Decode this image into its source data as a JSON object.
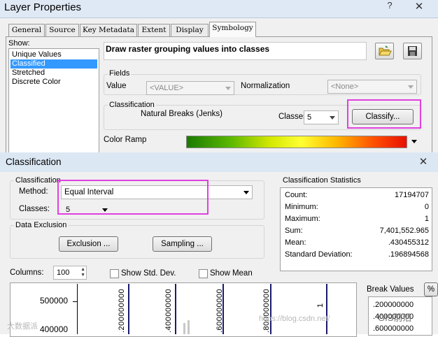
{
  "layer_properties": {
    "title": "Layer Properties",
    "tabs": [
      "General",
      "Source",
      "Key Metadata",
      "Extent",
      "Display",
      "Symbology"
    ],
    "selected_tab": "Symbology",
    "show_label": "Show:",
    "show_items": [
      "Unique Values",
      "Classified",
      "Stretched",
      "Discrete Color"
    ],
    "selected_show": "Classified",
    "description": "Draw raster grouping values into classes",
    "fields": {
      "group_label": "Fields",
      "value_label": "Value",
      "value_field": "<VALUE>",
      "normalization_label": "Normalization",
      "normalization_field": "<None>"
    },
    "classification": {
      "group_label": "Classification",
      "method": "Natural Breaks (Jenks)",
      "classes_label": "Classes",
      "classes_value": "5",
      "classify_button": "Classify..."
    },
    "color_ramp_label": "Color Ramp"
  },
  "classification_dialog": {
    "title": "Classification",
    "classification_group": "Classification",
    "method_label": "Method:",
    "method_value": "Equal Interval",
    "classes_label": "Classes:",
    "classes_value": "5",
    "data_exclusion_group": "Data Exclusion",
    "exclusion_button": "Exclusion ...",
    "sampling_button": "Sampling ...",
    "statistics": {
      "group_label": "Classification Statistics",
      "rows": [
        {
          "label": "Count:",
          "value": "17194707"
        },
        {
          "label": "Minimum:",
          "value": "0"
        },
        {
          "label": "Maximum:",
          "value": "1"
        },
        {
          "label": "Sum:",
          "value": "7,401,552.965"
        },
        {
          "label": "Mean:",
          "value": ".430455312"
        },
        {
          "label": "Standard Deviation:",
          "value": ".196894568"
        }
      ]
    },
    "columns_label": "Columns:",
    "columns_value": "100",
    "show_std_dev": "Show Std. Dev.",
    "show_mean": "Show Mean",
    "histogram": {
      "y_ticks": [
        "500000",
        "400000"
      ],
      "break_labels": [
        ".200000000",
        ".400000000",
        ".600000000",
        ".800000000",
        "1"
      ]
    },
    "break_values_label": "Break Values",
    "percent_button": "%",
    "break_values": [
      ".200000000",
      ".400000000",
      ".600000000"
    ]
  },
  "watermarks": {
    "left": "大数据派",
    "center": "https://blog.csdn.net/",
    "right": "GIS前沿"
  },
  "colors": {
    "highlight": "#e040e0",
    "selection": "#3399ff",
    "title_bar": "#dce7f4"
  }
}
